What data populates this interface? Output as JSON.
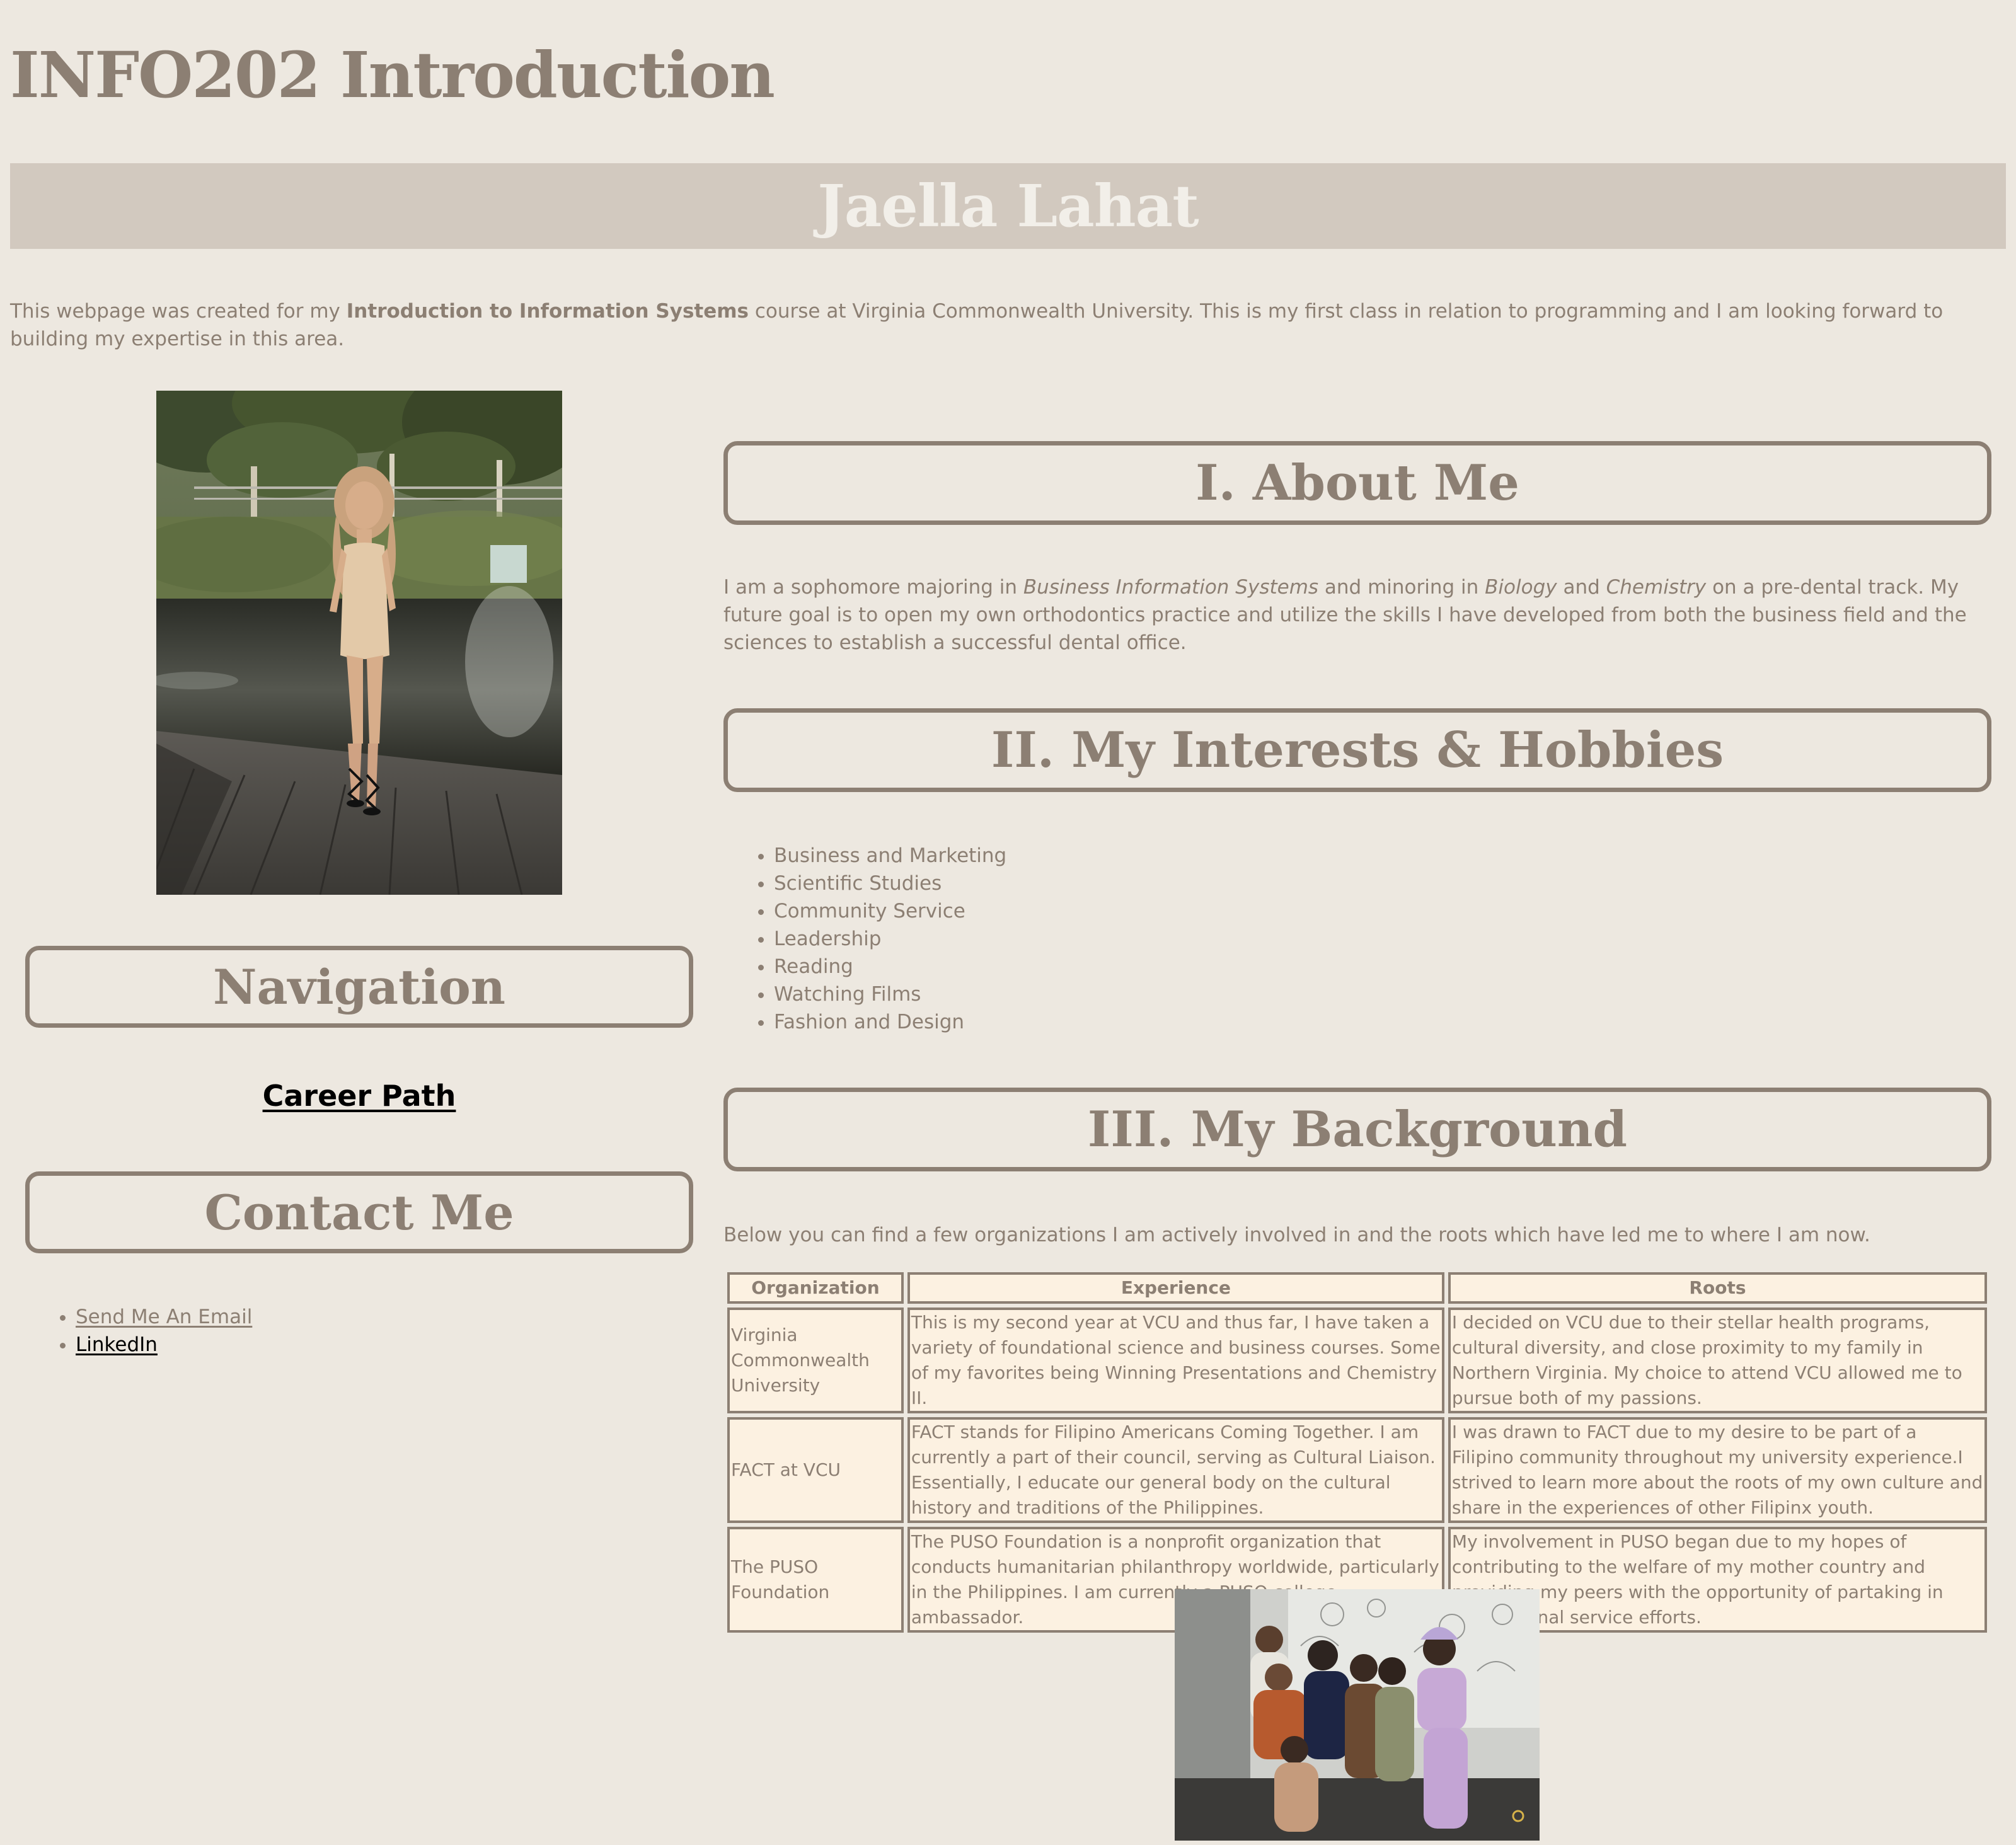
{
  "header": {
    "title": "INFO202 Introduction",
    "name": "Jaella Lahat"
  },
  "intro": {
    "before": "This webpage was created for my ",
    "course": "Introduction to Information Systems",
    "after": " course at Virginia Commonwealth University. This is my first class in relation to programming and I am looking forward to building my expertise in this area."
  },
  "sidebar": {
    "navigation_heading": "Navigation",
    "career_link": "Career Path",
    "contact_heading": "Contact Me",
    "contact_links": [
      "Send Me An Email",
      "LinkedIn"
    ]
  },
  "about": {
    "heading": "I. About Me",
    "text_1": "I am a sophomore majoring in ",
    "major": "Business Information Systems",
    "text_2": " and minoring in ",
    "minor_1": "Biology",
    "text_3": " and ",
    "minor_2": "Chemistry",
    "text_4": " on a pre-dental track. My future goal is to open my own orthodontics practice and utilize the skills I have developed from both the business field and the sciences to establish a successful dental office."
  },
  "interests": {
    "heading": "II. My Interests & Hobbies",
    "items": [
      "Business and Marketing",
      "Scientific Studies",
      "Community Service",
      "Leadership",
      "Reading",
      "Watching Films",
      "Fashion and Design"
    ]
  },
  "background": {
    "heading": "III. My Background",
    "intro": "Below you can find a few organizations I am actively involved in and the roots which have led me to where I am now.",
    "columns": [
      "Organization",
      "Experience",
      "Roots"
    ],
    "rows": [
      {
        "organization": "Virginia Commonwealth University",
        "experience": "This is my second year at VCU and thus far, I have taken a variety of foundational science and business courses. Some of my favorites being Winning Presentations and Chemistry II.",
        "roots": "I decided on VCU due to their stellar health programs, cultural diversity, and close proximity to my family in Northern Virginia. My choice to attend VCU allowed me to pursue both of my passions."
      },
      {
        "organization": "FACT at VCU",
        "experience": "FACT stands for Filipino Americans Coming Together. I am currently a part of their council, serving as Cultural Liaison. Essentially, I educate our general body on the cultural history and traditions of the Philippines.",
        "roots": "I was drawn to FACT due to my desire to be part of a Filipino community throughout my university experience.I strived to learn more about the roots of my own culture and share in the experiences of other Filipinx youth."
      },
      {
        "organization": "The PUSO Foundation",
        "experience": "The PUSO Foundation is a nonprofit organization that conducts humanitarian philanthropy worldwide, particularly in the Philippines. I am currently a PUSO college ambassador.",
        "roots": "My involvement in PUSO began due to my hopes of contributing to the welfare of my mother country and providing my peers with the opportunity of partaking in international service efforts."
      }
    ]
  },
  "colors": {
    "background": "#ede8e0",
    "text": "#8c7f73",
    "banner": "#d2c9bf",
    "banner_text": "#f2efe9",
    "table_cell": "#fcf1e1"
  }
}
